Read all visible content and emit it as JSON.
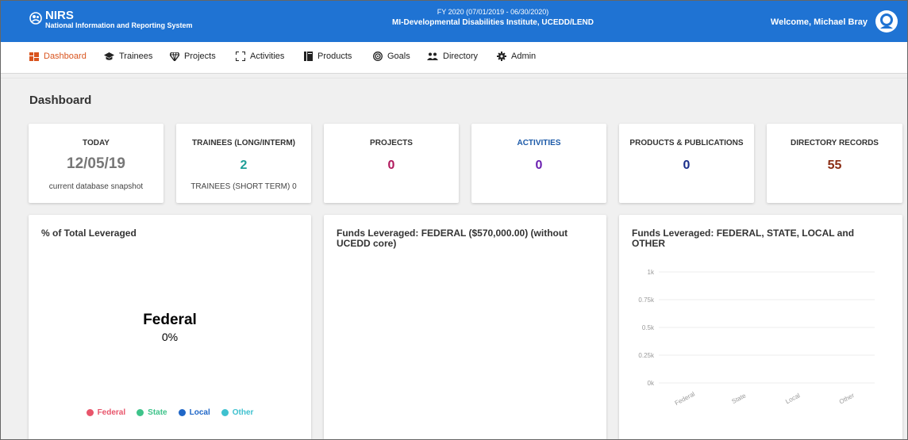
{
  "header": {
    "app_short": "NIRS",
    "app_full": "National Information and Reporting System",
    "fy": "FY 2020 (07/01/2019 - 06/30/2020)",
    "institute": "MI-Developmental Disabilities Institute, UCEDD/LEND",
    "welcome": "Welcome, Michael Bray"
  },
  "nav": {
    "items": [
      {
        "label": "Dashboard",
        "icon": "dashboard-icon",
        "active": true
      },
      {
        "label": "Trainees",
        "icon": "graduation-cap-icon"
      },
      {
        "label": "Projects",
        "icon": "diamond-icon"
      },
      {
        "label": "Activities",
        "icon": "expand-icon"
      },
      {
        "label": "Products",
        "icon": "book-icon"
      },
      {
        "label": "Goals",
        "icon": "target-icon"
      },
      {
        "label": "Directory",
        "icon": "users-icon"
      },
      {
        "label": "Admin",
        "icon": "gear-icon"
      }
    ]
  },
  "page": {
    "title": "Dashboard"
  },
  "stats": {
    "today": {
      "label": "TODAY",
      "value": "12/05/19",
      "sub": "current database snapshot"
    },
    "trainees": {
      "label": "TRAINEES (LONG/INTERM)",
      "value": "2",
      "sub": "TRAINEES (SHORT TERM) 0"
    },
    "projects": {
      "label": "PROJECTS",
      "value": "0"
    },
    "activities": {
      "label": "ACTIVITIES",
      "value": "0"
    },
    "products": {
      "label": "PRODUCTS & PUBLICATIONS",
      "value": "0"
    },
    "directory": {
      "label": "DIRECTORY RECORDS",
      "value": "55"
    }
  },
  "panels": {
    "leveraged": {
      "title": "% of Total Leveraged",
      "center_label": "Federal",
      "center_value": "0%",
      "legend": [
        {
          "label": "Federal",
          "color": "#e8556b"
        },
        {
          "label": "State",
          "color": "#3ec38a"
        },
        {
          "label": "Local",
          "color": "#2067c7"
        },
        {
          "label": "Other",
          "color": "#3fc1cf"
        }
      ]
    },
    "federal": {
      "title": "Funds Leveraged: FEDERAL ($570,000.00) (without UCEDD core)"
    },
    "all_sources": {
      "title": "Funds Leveraged: FEDERAL, STATE, LOCAL and OTHER"
    }
  },
  "chart_data": {
    "type": "bar",
    "title": "Funds Leveraged: FEDERAL, STATE, LOCAL and OTHER",
    "categories": [
      "Federal",
      "State",
      "Local",
      "Other"
    ],
    "values": [
      0,
      0,
      0,
      0
    ],
    "ylim": [
      0,
      1000
    ],
    "yticks": [
      "0k",
      "0.25k",
      "0.5k",
      "0.75k",
      "1k"
    ],
    "grid": true
  },
  "colors": {
    "topbar": "#1f73d3",
    "nav_active": "#d9541e",
    "today_value": "#777777",
    "trainees_value": "#1e9e97",
    "projects_value": "#b0185c",
    "activities_value": "#6a1fb0",
    "activities_label": "#1c5aa8",
    "products_value": "#1a2e8a",
    "directory_value": "#8a2d14"
  }
}
